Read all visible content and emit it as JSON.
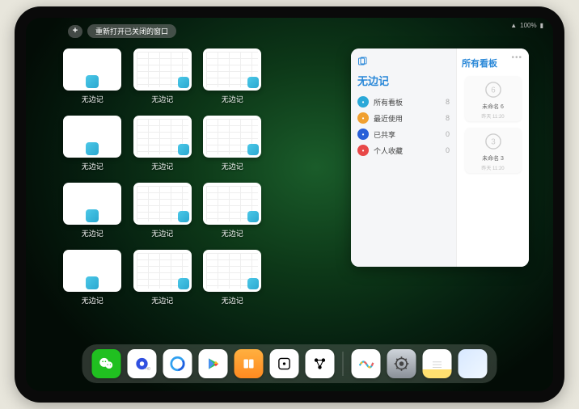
{
  "status": {
    "time": "",
    "wifi": "᯾",
    "battery": "100%"
  },
  "topbar": {
    "plus": "+",
    "reopen_label": "重新打开已关闭的窗口"
  },
  "thumbs": [
    {
      "kind": "blank",
      "label": "无边记"
    },
    {
      "kind": "grid",
      "label": "无边记"
    },
    {
      "kind": "grid",
      "label": "无边记"
    },
    {
      "kind": "empty",
      "label": ""
    },
    {
      "kind": "blank",
      "label": "无边记"
    },
    {
      "kind": "grid",
      "label": "无边记"
    },
    {
      "kind": "grid",
      "label": "无边记"
    },
    {
      "kind": "empty",
      "label": ""
    },
    {
      "kind": "blank",
      "label": "无边记"
    },
    {
      "kind": "grid",
      "label": "无边记"
    },
    {
      "kind": "grid",
      "label": "无边记"
    },
    {
      "kind": "empty",
      "label": ""
    },
    {
      "kind": "blank",
      "label": "无边记"
    },
    {
      "kind": "grid",
      "label": "无边记"
    },
    {
      "kind": "grid",
      "label": "无边记"
    }
  ],
  "panel": {
    "title": "无边记",
    "right_title": "所有看板",
    "rows": [
      {
        "icon_color": "blue",
        "label": "所有看板",
        "count": "8"
      },
      {
        "icon_color": "orange",
        "label": "最近使用",
        "count": "8"
      },
      {
        "icon_color": "darkblue",
        "label": "已共享",
        "count": "0"
      },
      {
        "icon_color": "red",
        "label": "个人收藏",
        "count": "0"
      }
    ],
    "cards": [
      {
        "glyph": "6",
        "label": "未命名 6",
        "sub": "昨天 11:20"
      },
      {
        "glyph": "3",
        "label": "未命名 3",
        "sub": "昨天 11:20"
      }
    ]
  },
  "dock": {
    "apps": [
      {
        "name": "wechat"
      },
      {
        "name": "quark"
      },
      {
        "name": "qqb"
      },
      {
        "name": "play"
      },
      {
        "name": "books"
      },
      {
        "name": "dice"
      },
      {
        "name": "graph"
      }
    ],
    "apps2": [
      {
        "name": "freeform"
      },
      {
        "name": "settings"
      },
      {
        "name": "notes"
      },
      {
        "name": "library"
      }
    ]
  }
}
